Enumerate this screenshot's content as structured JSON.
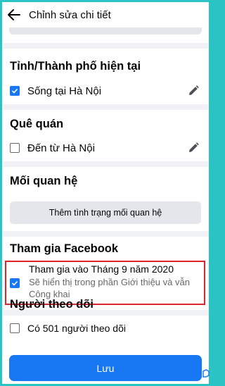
{
  "header": {
    "title": "Chỉnh sửa chi tiết"
  },
  "current_city": {
    "section_title": "Tỉnh/Thành phố hiện tại",
    "label": "Sống tại Hà Nội",
    "checked": true
  },
  "hometown": {
    "section_title": "Quê quán",
    "label": "Đến từ Hà Nội",
    "checked": false
  },
  "relationship": {
    "section_title": "Mối quan hệ",
    "button_label": "Thêm tình trạng mối quan hệ"
  },
  "joined": {
    "section_title": "Tham gia Facebook",
    "label": "Tham gia vào Tháng 9 năm 2020",
    "sublabel": "Sẽ hiển thị trong phần Giới thiệu và vẫn Công khai",
    "checked": true
  },
  "followers": {
    "section_title": "Người theo dõi",
    "label": "Có 501 người theo dõi"
  },
  "footer": {
    "save_label": "Lưu"
  },
  "colors": {
    "accent": "#1877f2",
    "highlight": "#e0242e",
    "frame": "#2bc4c4"
  }
}
